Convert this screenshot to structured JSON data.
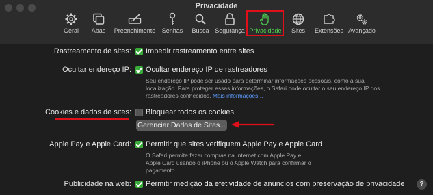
{
  "window": {
    "title": "Privacidade"
  },
  "toolbar": {
    "tabs": [
      {
        "label": "Geral",
        "icon": "gear-icon"
      },
      {
        "label": "Abas",
        "icon": "tabs-icon"
      },
      {
        "label": "Preenchimento",
        "icon": "pencil-field-icon"
      },
      {
        "label": "Senhas",
        "icon": "key-icon"
      },
      {
        "label": "Busca",
        "icon": "magnifier-icon"
      },
      {
        "label": "Segurança",
        "icon": "lock-icon"
      },
      {
        "label": "Privacidade",
        "icon": "hand-icon"
      },
      {
        "label": "Sites",
        "icon": "globe-icon"
      },
      {
        "label": "Extensões",
        "icon": "puzzle-icon"
      },
      {
        "label": "Avançado",
        "icon": "gears-icon"
      }
    ],
    "active": "Privacidade",
    "active_color": "#4fd14f"
  },
  "settings": {
    "tracking": {
      "label": "Rastreamento de sites:",
      "option": "Impedir rastreamento entre sites",
      "checked": true
    },
    "hide_ip": {
      "label": "Ocultar endereço IP:",
      "option": "Ocultar endereço IP de rastreadores",
      "checked": true,
      "desc_1": "Seu endereço IP pode ser usado para determinar informações pessoais, como a sua",
      "desc_2": "localização. Para proteger essas informações, o Safari pode ocultar o seu endereço IP dos",
      "desc_3": "rastreadores conhecidos.",
      "more": "Mais informações..."
    },
    "cookies": {
      "label": "Cookies e dados de sites:",
      "option": "Bloquear todos os cookies",
      "checked": false,
      "button": "Gerenciar Dados de Sites..."
    },
    "apple_pay": {
      "label": "Apple Pay e Apple Card:",
      "option": "Permitir que sites verifiquem Apple Pay e Apple Card",
      "checked": true,
      "desc_1": "O Safari permite fazer compras na Internet com Apple Pay e",
      "desc_2": "Apple Card usando o iPhone ou o Apple Watch para confirmar o",
      "desc_3": "pagamento."
    },
    "ads": {
      "label": "Publicidade na web:",
      "option": "Permitir medição da efetividade de anúncios com preservação de privacidade",
      "checked": true
    }
  },
  "help": {
    "label": "?"
  },
  "annotation_color": "#e0101a"
}
